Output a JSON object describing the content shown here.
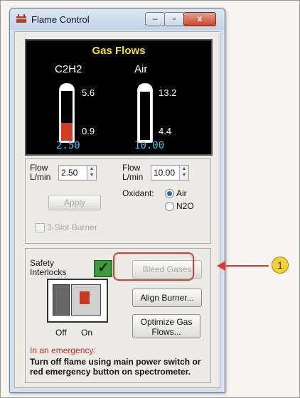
{
  "window": {
    "title": "Flame Control",
    "close_glyph": "x"
  },
  "gas_display": {
    "title": "Gas Flows",
    "c2h2": {
      "name": "C2H2",
      "max": "5.6",
      "min": "0.9",
      "value": "2.50",
      "fill_fraction": 0.35
    },
    "air": {
      "name": "Air",
      "max": "13.2",
      "min": "4.4",
      "value": "10.00"
    }
  },
  "flow": {
    "left_label_top": "Flow",
    "left_label_bottom": "L/min",
    "left_value": "2.50",
    "right_label_top": "Flow",
    "right_label_bottom": "L/min",
    "right_value": "10.00",
    "apply_button": "Apply",
    "oxidant_label": "Oxidant:",
    "oxidant_options": [
      "Air",
      "N2O"
    ],
    "oxidant_selected": "Air",
    "three_slot_label": "3-Slot Burner"
  },
  "safety": {
    "label_line1": "Safety",
    "label_line2": "Interlocks",
    "check_glyph": "✓",
    "off_label": "Off",
    "on_label": "On",
    "bleed_button": "Bleed Gases",
    "align_button": "Align Burner...",
    "optimize_line1": "Optimize Gas",
    "optimize_line2": "Flows...",
    "emergency_heading": "In an emergency:",
    "emergency_text": "Turn off flame using main power switch or red emergency button on spectrometer."
  },
  "callout": {
    "number": "1"
  },
  "colors": {
    "accent_red": "#d63a3a",
    "flow_value": "#4ec7e8",
    "title_yellow": "#f4e22a"
  }
}
